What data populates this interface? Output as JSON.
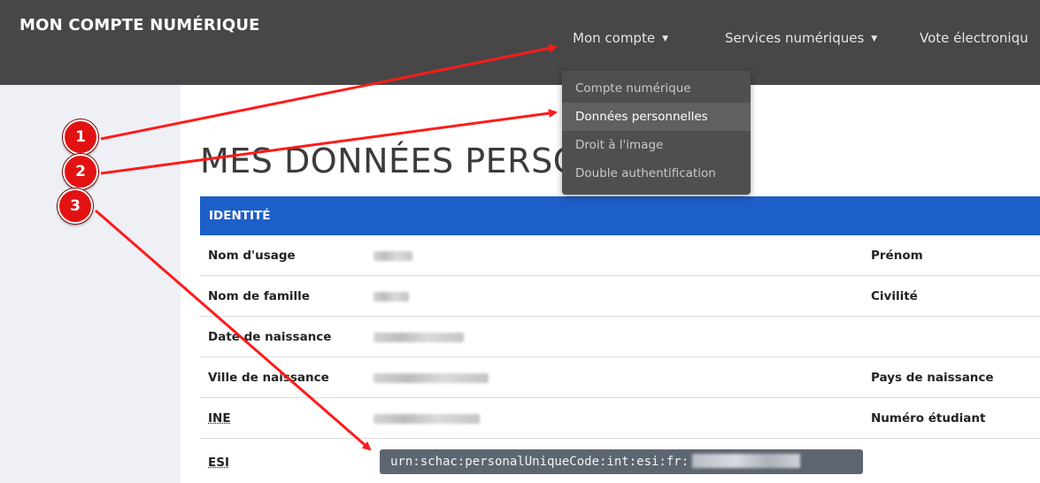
{
  "header": {
    "brand": "MON COMPTE NUMÉRIQUE",
    "nav": [
      {
        "label": "Mon compte"
      },
      {
        "label": "Services numériques"
      },
      {
        "label": "Vote électroniqu"
      }
    ],
    "caret_icon": "caret-down-icon"
  },
  "dropdown": {
    "items": [
      {
        "label": "Compte numérique",
        "active": false
      },
      {
        "label": "Données personnelles",
        "active": true
      },
      {
        "label": "Droit à l'image",
        "active": false
      },
      {
        "label": "Double authentification",
        "active": false
      }
    ]
  },
  "page": {
    "title": "MES DONNÉES PERSON"
  },
  "identity": {
    "section_title": "IDENTITÉ",
    "rows": [
      {
        "label": "Nom d'usage",
        "label2": "Prénom"
      },
      {
        "label": "Nom de famille",
        "label2": "Civilité"
      },
      {
        "label": "Date de naissance",
        "label2": ""
      },
      {
        "label": "Ville de naissance",
        "label2": "Pays de naissance"
      },
      {
        "label": "INE",
        "label2": "Numéro étudiant"
      },
      {
        "label": "ESI",
        "value": "urn:schac:personalUniqueCode:int:esi:fr:"
      }
    ]
  },
  "annotations": {
    "badges": [
      "1",
      "2",
      "3"
    ],
    "arrow_color": "#ff1a1a",
    "badge_color": "#e31212"
  },
  "colors": {
    "topbar": "#474747",
    "table_header": "#1d5fc9",
    "dropdown": "#4f4f4f"
  }
}
